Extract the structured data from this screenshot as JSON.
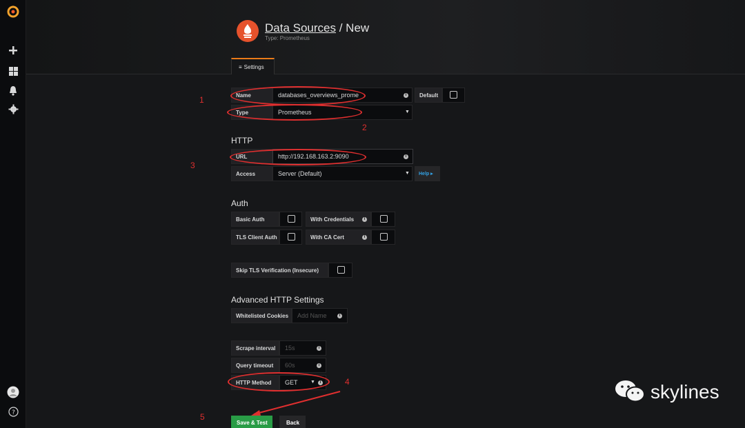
{
  "header": {
    "title_link": "Data Sources",
    "title_rest": " / New",
    "subtitle": "Type: Prometheus",
    "tab_label": "Settings"
  },
  "form": {
    "name_label": "Name",
    "name_value": "databases_overviews_prome",
    "default_label": "Default",
    "type_label": "Type",
    "type_value": "Prometheus",
    "http_heading": "HTTP",
    "url_label": "URL",
    "url_value": "http://192.168.163.2:9090",
    "access_label": "Access",
    "access_value": "Server (Default)",
    "help_label": "Help ▸",
    "auth_heading": "Auth",
    "basic_auth_label": "Basic Auth",
    "with_credentials_label": "With Credentials",
    "tls_client_auth_label": "TLS Client Auth",
    "with_ca_cert_label": "With CA Cert",
    "skip_tls_label": "Skip TLS Verification (Insecure)",
    "advanced_heading": "Advanced HTTP Settings",
    "whitelisted_label": "Whitelisted Cookies",
    "whitelisted_placeholder": "Add Name",
    "scrape_label": "Scrape interval",
    "scrape_placeholder": "15s",
    "query_timeout_label": "Query timeout",
    "query_timeout_placeholder": "60s",
    "http_method_label": "HTTP Method",
    "http_method_value": "GET",
    "save_button": "Save & Test",
    "back_button": "Back"
  },
  "annotations": {
    "n1": "1",
    "n2": "2",
    "n3": "3",
    "n4": "4",
    "n5": "5"
  },
  "watermark": {
    "text": "skylines"
  },
  "colors": {
    "accent": "#eb7b18",
    "prometheus": "#e6522c",
    "save_green": "#299c46",
    "annotation_red": "#e02f2f",
    "help_blue": "#33a2e5"
  },
  "icons": {
    "sidebar": [
      "grafana-logo-icon",
      "plus-icon",
      "dashboards-icon",
      "bell-icon",
      "gear-icon",
      "avatar-icon",
      "help-icon"
    ]
  }
}
